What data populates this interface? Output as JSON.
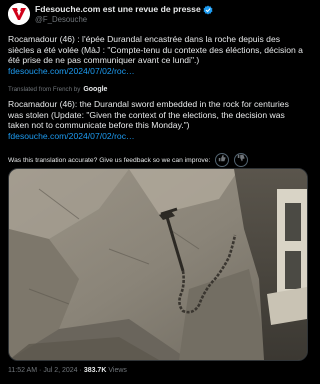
{
  "author": {
    "name": "Fdesouche.com est une revue de presse",
    "handle": "@F_Desouche",
    "avatar_icon": "red-logo-avatar",
    "verified_icon": "verified-badge-icon",
    "verified_color": "#1d9bf0"
  },
  "tweet": {
    "original_text": "Rocamadour (46) : l'épée Durandal encastrée dans la roche depuis des siècles a été volée (MàJ : \"Compte-tenu du contexte des éléctions, décision a été prise de ne pas communiquer avant ce lundi\".)",
    "original_link": "fdesouche.com/2024/07/02/roc…",
    "translated_by_label": "Translated from French by",
    "translator": "Google",
    "translated_text": "Rocamadour (46): the Durandal sword embedded in the rock for centuries was stolen (Update: \"Given the context of the elections, the decision was taken not to communicate before this Monday.\")",
    "translated_link": "fdesouche.com/2024/07/02/roc…",
    "feedback_prompt": "Was this translation accurate? Give us feedback so we can improve:",
    "feedback_up_icon": "thumbs-up-icon",
    "feedback_down_icon": "thumbs-down-icon"
  },
  "media": {
    "subject": "photo-sword-in-rock"
  },
  "meta": {
    "time": "11:52 AM",
    "separator": "·",
    "date": "Jul 2, 2024",
    "views_count": "383.7K",
    "views_label": "Views"
  },
  "colors": {
    "background": "#000000",
    "text": "#e7e9ea",
    "muted": "#71767b",
    "link": "#1d9bf0"
  }
}
